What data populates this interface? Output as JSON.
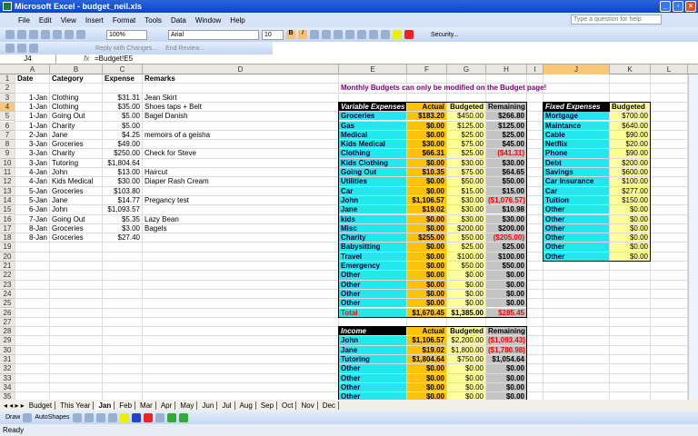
{
  "window": {
    "title": "Microsoft Excel - budget_neil.xls",
    "min": "_",
    "max": "▫",
    "close": "×"
  },
  "menu": [
    "File",
    "Edit",
    "View",
    "Insert",
    "Format",
    "Tools",
    "Data",
    "Window",
    "Help"
  ],
  "help_placeholder": "Type a question for help",
  "toolbar": {
    "zoom": "100%",
    "font": "Arial",
    "size": "10",
    "bold": "B",
    "italic": "I",
    "security": "Security...",
    "reply": "Reply with Changes...",
    "end_review": "End Review..."
  },
  "formula_bar": {
    "name_box": "J4",
    "fx": "fx",
    "formula": "=Budget!E5"
  },
  "columns": [
    "A",
    "B",
    "C",
    "D",
    "E",
    "F",
    "G",
    "H",
    "I",
    "J",
    "K",
    "L"
  ],
  "selected": {
    "col": "J",
    "row": 4
  },
  "log": {
    "headers": [
      "Date",
      "Category",
      "Expense",
      "Remarks"
    ],
    "rows": [
      [
        "1-Jan",
        "Clothing",
        "$31.31",
        "Jean Skirt"
      ],
      [
        "1-Jan",
        "Clothing",
        "$35.00",
        "Shoes taps + Belt"
      ],
      [
        "1-Jan",
        "Going Out",
        "$5.00",
        "Bagel Danish"
      ],
      [
        "1-Jan",
        "Charity",
        "$5.00",
        ""
      ],
      [
        "2-Jan",
        "Jane",
        "$4.25",
        "memoirs of a geisha"
      ],
      [
        "3-Jan",
        "Groceries",
        "$49.00",
        ""
      ],
      [
        "3-Jan",
        "Charity",
        "$250.00",
        "Check for Steve"
      ],
      [
        "3-Jan",
        "Tutoring",
        "$1,804.64",
        ""
      ],
      [
        "4-Jan",
        "John",
        "$13.00",
        "Haircut"
      ],
      [
        "4-Jan",
        "Kids Medical",
        "$30.00",
        "Diaper Rash Cream"
      ],
      [
        "5-Jan",
        "Groceries",
        "$103.80",
        ""
      ],
      [
        "5-Jan",
        "Jane",
        "$14.77",
        "Pregancy test"
      ],
      [
        "6-Jan",
        "John",
        "$1,093.57",
        ""
      ],
      [
        "7-Jan",
        "Going Out",
        "$5.35",
        "Lazy Bean"
      ],
      [
        "8-Jan",
        "Groceries",
        "$3.00",
        "Bagels"
      ],
      [
        "8-Jan",
        "Groceries",
        "$27.40",
        ""
      ]
    ]
  },
  "notice": "Monthly Budgets can only be modified on the Budget page!",
  "variable": {
    "headers": [
      "Variable Expenses",
      "Actual",
      "Budgeted",
      "Remaining"
    ],
    "rows": [
      [
        "Groceries",
        "$183.20",
        "$450.00",
        "$266.80"
      ],
      [
        "Gas",
        "$0.00",
        "$125.00",
        "$125.00"
      ],
      [
        "Medical",
        "$0.00",
        "$25.00",
        "$25.00"
      ],
      [
        "Kids Medical",
        "$30.00",
        "$75.00",
        "$45.00"
      ],
      [
        "Clothing",
        "$66.31",
        "$25.00",
        "($41.31)"
      ],
      [
        "Kids Clothing",
        "$0.00",
        "$30.00",
        "$30.00"
      ],
      [
        "Going Out",
        "$10.35",
        "$75.00",
        "$64.65"
      ],
      [
        "Utilities",
        "$0.00",
        "$50.00",
        "$50.00"
      ],
      [
        "Car",
        "$0.00",
        "$15.00",
        "$15.00"
      ],
      [
        "John",
        "$1,106.57",
        "$30.00",
        "($1,076.57)"
      ],
      [
        "Jane",
        "$19.02",
        "$30.00",
        "$10.98"
      ],
      [
        "kids",
        "$0.00",
        "$30.00",
        "$30.00"
      ],
      [
        "Misc",
        "$0.00",
        "$200.00",
        "$200.00"
      ],
      [
        "Charity",
        "$255.00",
        "$50.00",
        "($205.00)"
      ],
      [
        "Babysitting",
        "$0.00",
        "$25.00",
        "$25.00"
      ],
      [
        "Travel",
        "$0.00",
        "$100.00",
        "$100.00"
      ],
      [
        "Emergency",
        "$0.00",
        "$50.00",
        "$50.00"
      ],
      [
        "Other",
        "$0.00",
        "$0.00",
        "$0.00"
      ],
      [
        "Other",
        "$0.00",
        "$0.00",
        "$0.00"
      ],
      [
        "Other",
        "$0.00",
        "$0.00",
        "$0.00"
      ],
      [
        "Other",
        "$0.00",
        "$0.00",
        "$0.00"
      ]
    ],
    "total": [
      "Total",
      "$1,670.45",
      "$1,385.00",
      "$285.45"
    ]
  },
  "income": {
    "headers": [
      "Income",
      "Actual",
      "Budgeted",
      "Remaining"
    ],
    "rows": [
      [
        "John",
        "$1,106.57",
        "$2,200.00",
        "($1,093.43)"
      ],
      [
        "Jane",
        "$19.02",
        "$1,800.00",
        "($1,780.98)"
      ],
      [
        "Tutoring",
        "$1,804.64",
        "$750.00",
        "$1,054.64"
      ],
      [
        "Other",
        "$0.00",
        "$0.00",
        "$0.00"
      ],
      [
        "Other",
        "$0.00",
        "$0.00",
        "$0.00"
      ],
      [
        "Other",
        "$0.00",
        "$0.00",
        "$0.00"
      ],
      [
        "Other",
        "$0.00",
        "$0.00",
        "$0.00"
      ]
    ]
  },
  "fixed": {
    "headers": [
      "Fixed Expenses",
      "Budgeted"
    ],
    "rows": [
      [
        "Mortgage",
        "$700.00"
      ],
      [
        "Maintance",
        "$640.00"
      ],
      [
        "Cable",
        "$90.00"
      ],
      [
        "Netflix",
        "$20.00"
      ],
      [
        "Phone",
        "$90.00"
      ],
      [
        "Debt",
        "$200.00"
      ],
      [
        "Savings",
        "$600.00"
      ],
      [
        "Car Insurance",
        "$100.00"
      ],
      [
        "Car",
        "$277.00"
      ],
      [
        "Tuition",
        "$150.00"
      ],
      [
        "Other",
        "$0.00"
      ],
      [
        "Other",
        "$0.00"
      ],
      [
        "Other",
        "$0.00"
      ],
      [
        "Other",
        "$0.00"
      ],
      [
        "Other",
        "$0.00"
      ],
      [
        "Other",
        "$0.00"
      ]
    ]
  },
  "sheet_tabs": [
    "Budget",
    "This Year",
    "Jan",
    "Feb",
    "Mar",
    "Apr",
    "May",
    "Jun",
    "Jul",
    "Aug",
    "Sep",
    "Oct",
    "Nov",
    "Dec"
  ],
  "active_tab": "Jan",
  "draw_toolbar": {
    "draw": "Draw",
    "autoshapes": "AutoShapes"
  },
  "status": "Ready"
}
